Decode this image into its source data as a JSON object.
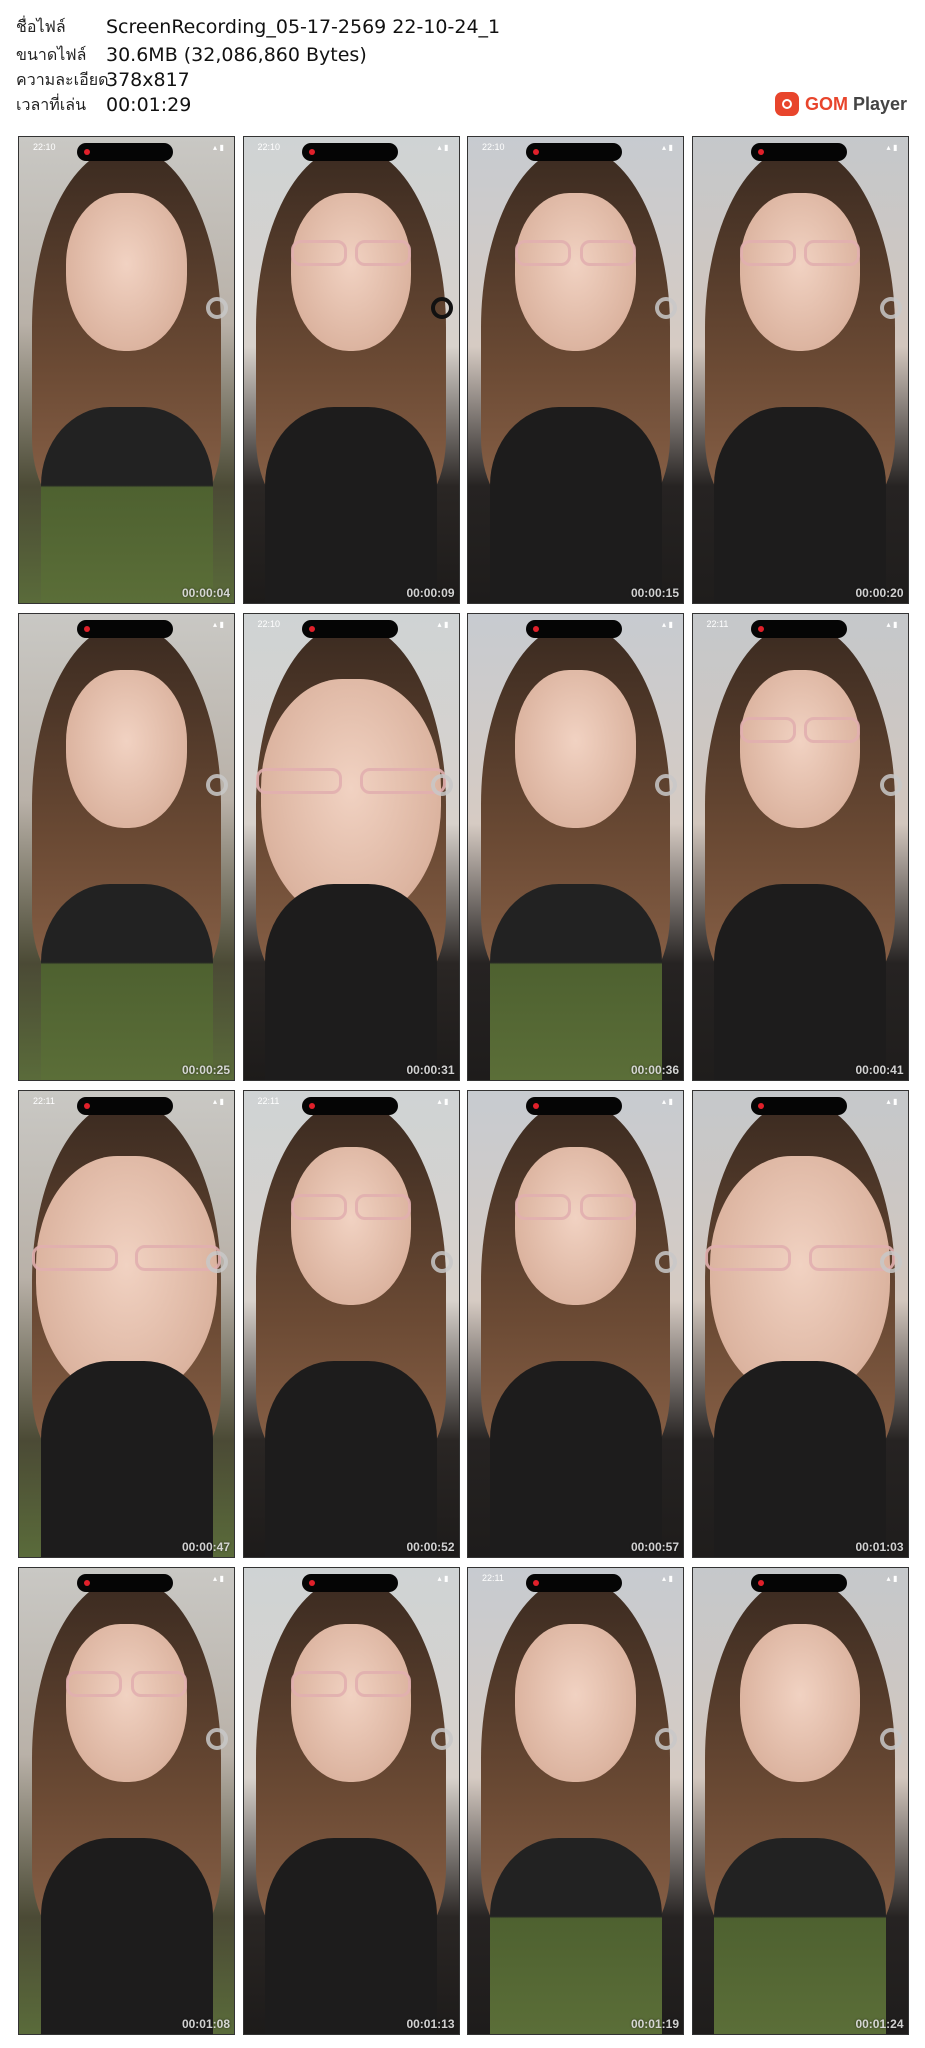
{
  "file_info": {
    "filename_label": "ชื่อไฟล์",
    "filename": "ScreenRecording_05-17-2569 22-10-24_1",
    "filesize_label": "ขนาดไฟล์",
    "filesize": "30.6MB (32,086,860 Bytes)",
    "resolution_label": "ความละเอียด",
    "resolution": "378x817",
    "duration_label": "เวลาที่เล่น",
    "duration": "00:01:29"
  },
  "logo": {
    "brand": "GOM",
    "product": "Player"
  },
  "thumbnails": [
    {
      "time": "00:00:04",
      "clock": "22:10",
      "scene": "closeup-smile"
    },
    {
      "time": "00:00:09",
      "clock": "22:10",
      "scene": "glasses-pout"
    },
    {
      "time": "00:00:15",
      "clock": "22:10",
      "scene": "glasses-smile"
    },
    {
      "time": "00:00:20",
      "clock": "",
      "scene": "glasses-smile"
    },
    {
      "time": "00:00:25",
      "clock": "",
      "scene": "blurred-move"
    },
    {
      "time": "00:00:31",
      "clock": "22:10",
      "scene": "very-close"
    },
    {
      "time": "00:00:36",
      "clock": "",
      "scene": "side-smile"
    },
    {
      "time": "00:00:41",
      "clock": "22:11",
      "scene": "glasses-talk"
    },
    {
      "time": "00:00:47",
      "clock": "22:11",
      "scene": "very-close"
    },
    {
      "time": "00:00:52",
      "clock": "22:11",
      "scene": "glasses-talk"
    },
    {
      "time": "00:00:57",
      "clock": "",
      "scene": "glasses-smile"
    },
    {
      "time": "00:01:03",
      "clock": "",
      "scene": "very-close"
    },
    {
      "time": "00:01:08",
      "clock": "",
      "scene": "glasses-smile"
    },
    {
      "time": "00:01:13",
      "clock": "",
      "scene": "glasses-talk"
    },
    {
      "time": "00:01:19",
      "clock": "22:11",
      "scene": "hair-down"
    },
    {
      "time": "00:01:24",
      "clock": "",
      "scene": "seated-far"
    }
  ]
}
